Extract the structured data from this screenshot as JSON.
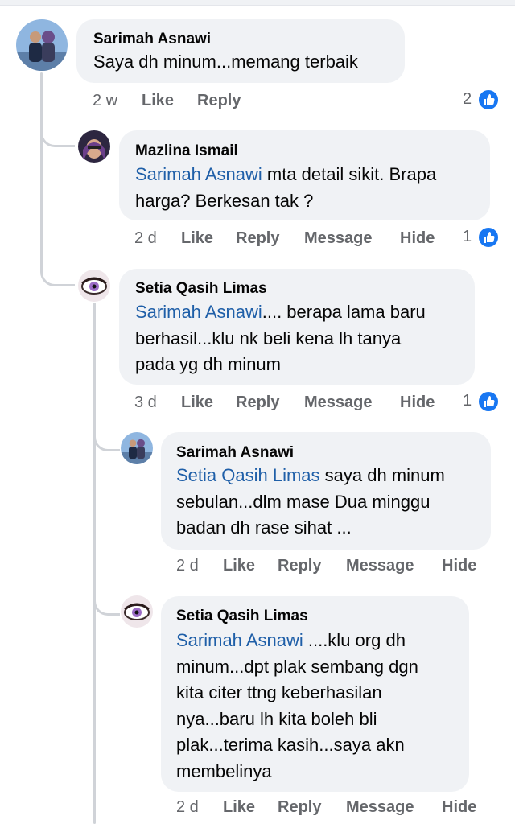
{
  "comments": [
    {
      "author": "Sarimah Asnawi",
      "mention": "",
      "lines": [
        "Saya dh minum...memang terbaik"
      ],
      "time": "2 w",
      "like": "Like",
      "reply": "Reply",
      "reactions": "2"
    },
    {
      "author": "Mazlina Ismail",
      "mention": "Sarimah Asnawi",
      "lines": [
        " mta detail sikit. Brapa",
        "harga? Berkesan tak ?"
      ],
      "time": "2 d",
      "like": "Like",
      "reply": "Reply",
      "message": "Message",
      "hide": "Hide",
      "reactions": "1"
    },
    {
      "author": "Setia Qasih Limas",
      "mention": "Sarimah Asnawi",
      "lines": [
        ".... berapa lama baru",
        "berhasil...klu nk beli kena lh tanya",
        "pada yg dh minum"
      ],
      "time": "3 d",
      "like": "Like",
      "reply": "Reply",
      "message": "Message",
      "hide": "Hide",
      "reactions": "1"
    },
    {
      "author": "Sarimah Asnawi",
      "mention": "Setia Qasih Limas",
      "lines": [
        " saya dh minum",
        "sebulan...dlm mase Dua minggu",
        "badan dh rase sihat ..."
      ],
      "time": "2 d",
      "like": "Like",
      "reply": "Reply",
      "message": "Message",
      "hide": "Hide"
    },
    {
      "author": "Setia Qasih Limas",
      "mention": "Sarimah Asnawi",
      "lines": [
        " ....klu org dh",
        "minum...dpt plak sembang dgn",
        "kita citer ttng keberhasilan",
        "nya...baru lh kita boleh bli",
        "plak...terima kasih...saya akn",
        "membelinya"
      ],
      "time": "2 d",
      "like": "Like",
      "reply": "Reply",
      "message": "Message",
      "hide": "Hide"
    }
  ],
  "colors": {
    "bubble": "#f0f2f5",
    "mention": "#1f5fa8",
    "meta": "#65676b",
    "like_blue": "#1877f2",
    "thread_line": "#d0d3d8"
  },
  "icons": {
    "reaction": "like-thumb-icon"
  }
}
